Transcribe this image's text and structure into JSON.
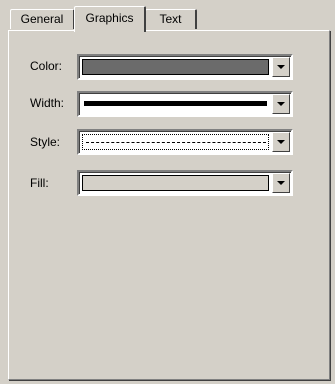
{
  "tabs": [
    {
      "label": "General",
      "active": false
    },
    {
      "label": "Graphics",
      "active": true
    },
    {
      "label": "Text",
      "active": false
    }
  ],
  "fields": {
    "color": {
      "label": "Color:",
      "value": "#6b6b6b"
    },
    "width": {
      "label": "Width:",
      "value": "thick solid line"
    },
    "style": {
      "label": "Style:",
      "value": "dashed line"
    },
    "fill": {
      "label": "Fill:",
      "value": "#d4d0c8"
    }
  },
  "icons": {
    "dropdown": "chevron-down-icon"
  },
  "colors": {
    "face": "#d4d0c8",
    "window": "#ffffff"
  }
}
